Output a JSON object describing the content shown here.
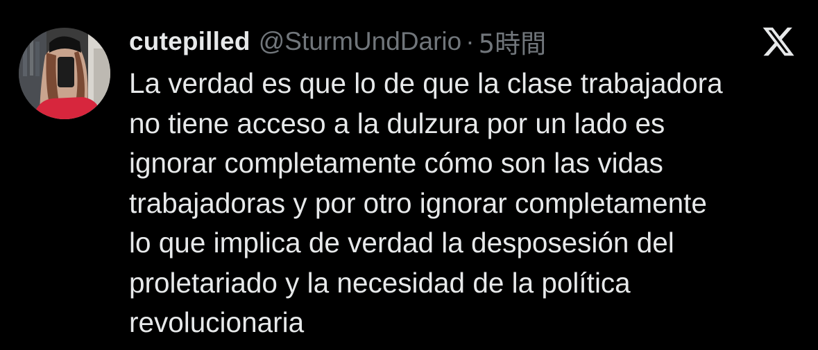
{
  "colors": {
    "background": "#000000",
    "text": "#e7e9ea",
    "secondary": "#71767b"
  },
  "tweet": {
    "display_name": "cutepilled",
    "handle": "@SturmUndDario",
    "separator": "·",
    "timestamp": "5時間",
    "avatar_icon": "profile-photo",
    "logo_icon": "x-logo-icon",
    "text_lines": [
      "La verdad es que lo de que la clase trabajadora",
      "no tiene acceso a la dulzura por un lado es",
      "ignorar completamente cómo son las vidas",
      "trabajadoras y por otro ignorar completamente",
      "lo que implica de verdad la desposesión del",
      "proletariado y la necesidad de la política",
      "revolucionaria"
    ]
  }
}
